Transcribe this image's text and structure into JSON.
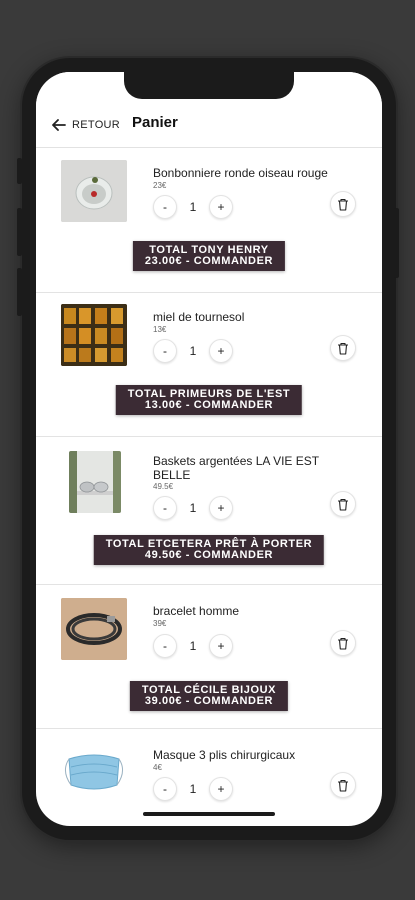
{
  "header": {
    "back_label": "RETOUR",
    "title": "Panier"
  },
  "items": [
    {
      "name": "Bonbonniere ronde oiseau rouge",
      "price": "23€",
      "quantity": "1",
      "decrement": "-",
      "increment": "+",
      "order_line1": "TOTAL TONY HENRY",
      "order_line2": "23.00€ - COMMANDER"
    },
    {
      "name": "miel de tournesol",
      "price": "13€",
      "quantity": "1",
      "decrement": "-",
      "increment": "+",
      "order_line1": "TOTAL PRIMEURS DE L'EST",
      "order_line2": "13.00€ - COMMANDER"
    },
    {
      "name": "Baskets argentées LA VIE EST BELLE",
      "price": "49.5€",
      "quantity": "1",
      "decrement": "-",
      "increment": "+",
      "order_line1": "TOTAL ETCETERA PRÊT À PORTER",
      "order_line2": "49.50€ - COMMANDER"
    },
    {
      "name": "bracelet homme",
      "price": "39€",
      "quantity": "1",
      "decrement": "-",
      "increment": "+",
      "order_line1": "TOTAL CÉCILE BIJOUX",
      "order_line2": "39.00€ - COMMANDER"
    },
    {
      "name": "Masque 3 plis chirurgicaux",
      "price": "4€",
      "quantity": "1",
      "decrement": "-",
      "increment": "+"
    }
  ],
  "icons": {
    "back": "arrow-left-icon",
    "delete": "trash-icon"
  },
  "colors": {
    "order_button_bg": "#3b2b34",
    "background": "#3a3a3a"
  }
}
